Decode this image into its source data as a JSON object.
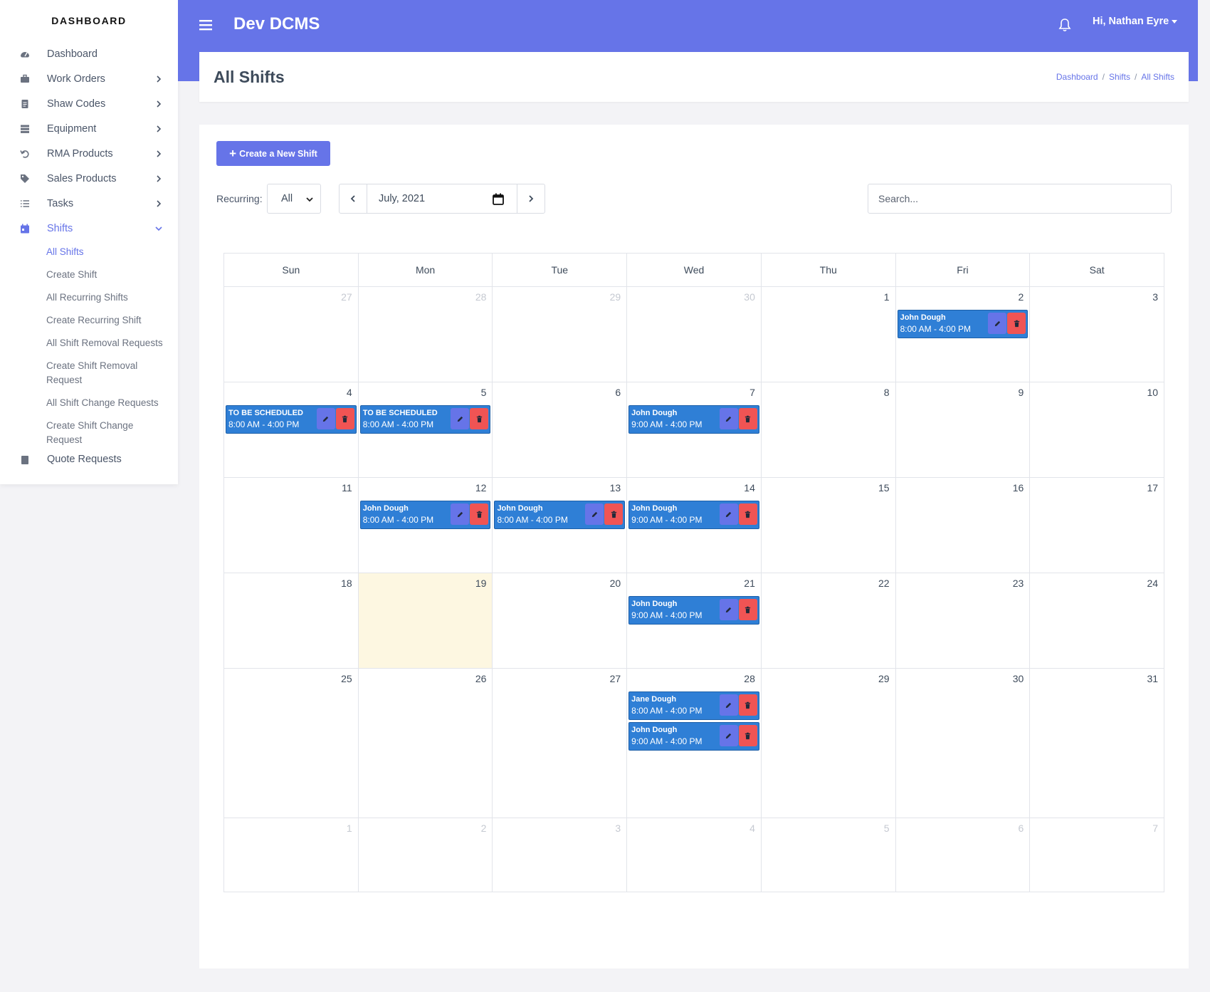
{
  "sidebar": {
    "brand": "DASHBOARD",
    "items": [
      {
        "label": "Dashboard",
        "icon": "gauge-icon",
        "chevron": false
      },
      {
        "label": "Work Orders",
        "icon": "toolbox-icon",
        "chevron": true
      },
      {
        "label": "Shaw Codes",
        "icon": "document-icon",
        "chevron": true
      },
      {
        "label": "Equipment",
        "icon": "server-icon",
        "chevron": true
      },
      {
        "label": "RMA Products",
        "icon": "undo-icon",
        "chevron": true
      },
      {
        "label": "Sales Products",
        "icon": "tag-icon",
        "chevron": true
      },
      {
        "label": "Tasks",
        "icon": "list-icon",
        "chevron": true
      },
      {
        "label": "Shifts",
        "icon": "calendar-icon",
        "chevron": true,
        "active": true
      }
    ],
    "sub_items": [
      {
        "label": "All Shifts",
        "active": true
      },
      {
        "label": "Create Shift"
      },
      {
        "label": "All Recurring Shifts"
      },
      {
        "label": "Create Recurring Shift"
      },
      {
        "label": "All Shift Removal Requests"
      },
      {
        "label": "Create Shift Removal Request"
      },
      {
        "label": "All Shift Change Requests"
      },
      {
        "label": "Create Shift Change Request"
      }
    ],
    "cut_item": "Quote Requests"
  },
  "header": {
    "app_title": "Dev DCMS",
    "user_greeting": "Hi, Nathan Eyre"
  },
  "page": {
    "title": "All Shifts",
    "breadcrumb": [
      "Dashboard",
      "Shifts",
      "All Shifts"
    ]
  },
  "toolbar": {
    "create_label": "Create a New Shift",
    "recurring_label": "Recurring:",
    "recurring_value": "All",
    "month_value": "July, 2021",
    "search_placeholder": "Search..."
  },
  "calendar": {
    "weekdays": [
      "Sun",
      "Mon",
      "Tue",
      "Wed",
      "Thu",
      "Fri",
      "Sat"
    ],
    "weeks": [
      [
        {
          "day": "27",
          "other": true
        },
        {
          "day": "28",
          "other": true
        },
        {
          "day": "29",
          "other": true
        },
        {
          "day": "30",
          "other": true
        },
        {
          "day": "1"
        },
        {
          "day": "2",
          "events": [
            {
              "name": "John Dough",
              "time": "8:00 AM - 4:00 PM"
            }
          ]
        },
        {
          "day": "3"
        }
      ],
      [
        {
          "day": "4",
          "events": [
            {
              "name": "TO BE SCHEDULED",
              "time": "8:00 AM - 4:00 PM"
            }
          ]
        },
        {
          "day": "5",
          "events": [
            {
              "name": "TO BE SCHEDULED",
              "time": "8:00 AM - 4:00 PM"
            }
          ]
        },
        {
          "day": "6"
        },
        {
          "day": "7",
          "events": [
            {
              "name": "John Dough",
              "time": "9:00 AM - 4:00 PM"
            }
          ]
        },
        {
          "day": "8"
        },
        {
          "day": "9"
        },
        {
          "day": "10"
        }
      ],
      [
        {
          "day": "11"
        },
        {
          "day": "12",
          "events": [
            {
              "name": "John Dough",
              "time": "8:00 AM - 4:00 PM"
            }
          ]
        },
        {
          "day": "13",
          "events": [
            {
              "name": "John Dough",
              "time": "8:00 AM - 4:00 PM"
            }
          ]
        },
        {
          "day": "14",
          "events": [
            {
              "name": "John Dough",
              "time": "9:00 AM - 4:00 PM"
            }
          ]
        },
        {
          "day": "15"
        },
        {
          "day": "16"
        },
        {
          "day": "17"
        }
      ],
      [
        {
          "day": "18"
        },
        {
          "day": "19",
          "today": true
        },
        {
          "day": "20"
        },
        {
          "day": "21",
          "events": [
            {
              "name": "John Dough",
              "time": "9:00 AM - 4:00 PM"
            }
          ]
        },
        {
          "day": "22"
        },
        {
          "day": "23"
        },
        {
          "day": "24"
        }
      ],
      [
        {
          "day": "25"
        },
        {
          "day": "26"
        },
        {
          "day": "27"
        },
        {
          "day": "28",
          "events": [
            {
              "name": "Jane Dough",
              "time": "8:00 AM - 4:00 PM"
            },
            {
              "name": "John Dough",
              "time": "9:00 AM - 4:00 PM"
            }
          ]
        },
        {
          "day": "29"
        },
        {
          "day": "30"
        },
        {
          "day": "31"
        }
      ],
      [
        {
          "day": "1",
          "other": true
        },
        {
          "day": "2",
          "other": true
        },
        {
          "day": "3",
          "other": true
        },
        {
          "day": "4",
          "other": true
        },
        {
          "day": "5",
          "other": true
        },
        {
          "day": "6",
          "other": true
        },
        {
          "day": "7",
          "other": true
        }
      ]
    ]
  },
  "colors": {
    "accent": "#6674e8",
    "event": "#2f7fd6",
    "delete": "#f05454",
    "today": "#fdf7e1"
  }
}
